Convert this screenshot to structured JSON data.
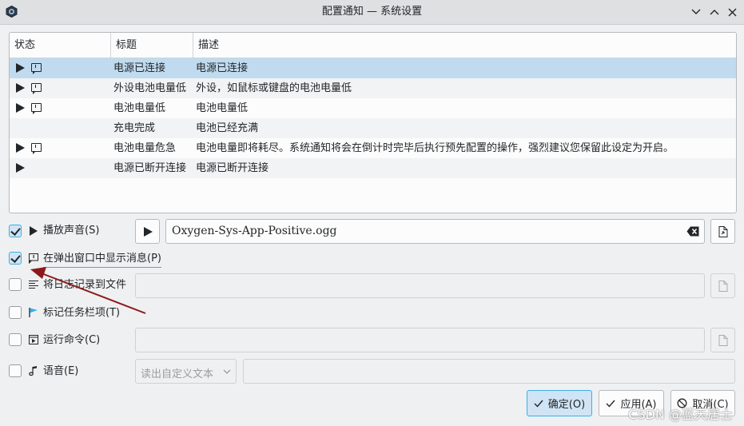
{
  "window": {
    "title": "配置通知 — 系统设置"
  },
  "table": {
    "headers": {
      "status": "状态",
      "title": "标题",
      "description": "描述"
    },
    "rows": [
      {
        "title": "电源已连接",
        "description": "电源已连接",
        "sound": true,
        "popup": true,
        "selected": true
      },
      {
        "title": "外设电池电量低",
        "description": "外设，如鼠标或键盘的电池电量低",
        "sound": true,
        "popup": true
      },
      {
        "title": "电池电量低",
        "description": "电池电量低",
        "sound": true,
        "popup": true
      },
      {
        "title": "充电完成",
        "description": "电池已经充满",
        "sound": false,
        "popup": false
      },
      {
        "title": "电池电量危急",
        "description": "电池电量即将耗尽。系统通知将会在倒计时完毕后执行预先配置的操作，强烈建议您保留此设定为开启。",
        "sound": true,
        "popup": true
      },
      {
        "title": "电源已断开连接",
        "description": "电源已断开连接",
        "sound": true,
        "popup": false
      }
    ]
  },
  "options": {
    "play_sound": {
      "label": "播放声音(S)",
      "checked": true,
      "file": "Oxygen-Sys-App-Positive.ogg"
    },
    "popup": {
      "label": "在弹出窗口中显示消息(P)",
      "checked": true
    },
    "log_file": {
      "label": "将日志记录到文件",
      "checked": false
    },
    "taskbar": {
      "label": "标记任务栏项(T)",
      "checked": false
    },
    "run_command": {
      "label": "运行命令(C)",
      "checked": false
    },
    "speech": {
      "label": "语音(E)",
      "checked": false,
      "select_value": "读出自定义文本"
    }
  },
  "buttons": {
    "ok": "确定(O)",
    "apply": "应用(A)",
    "cancel": "取消(C)"
  },
  "watermark": "CSDN @蓝天居士",
  "colors": {
    "accent": "#3daee9",
    "selection": "#c0dbef",
    "arrow": "#8b1a1a"
  }
}
